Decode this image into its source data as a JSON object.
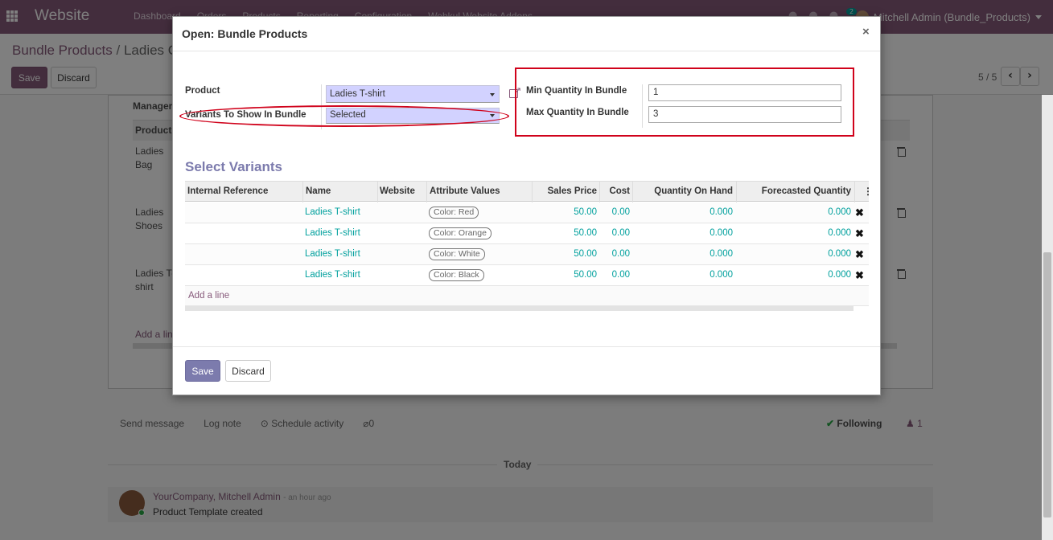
{
  "navbar": {
    "brand": "Website",
    "menu": [
      "Dashboard",
      "Orders",
      "Products",
      "Reporting",
      "Configuration",
      "Webkul Website Addons"
    ],
    "chat_count": "2",
    "user": "Mitchell Admin (Bundle_Products)"
  },
  "breadcrumb": {
    "parent": "Bundle Products",
    "separator": "/",
    "current": "Ladies C..."
  },
  "control": {
    "save": "Save",
    "discard": "Discard",
    "pager": "5 / 5"
  },
  "sheet": {
    "section": "Managem",
    "col_product": "Product",
    "rows": [
      "Ladies Bag",
      "Ladies Shoes",
      "Ladies T-shirt"
    ],
    "add_line": "Add a line"
  },
  "chatter": {
    "send_message": "Send message",
    "log_note": "Log note",
    "schedule": "Schedule activity",
    "attachments": "0",
    "following": "Following",
    "followers": "1",
    "today": "Today",
    "author": "YourCompany, Mitchell Admin",
    "time": "- an hour ago",
    "body": "Product Template created"
  },
  "modal": {
    "title": "Open: Bundle Products",
    "close": "×",
    "product_label": "Product",
    "product_value": "Ladies T-shirt",
    "variants_label": "Variants To Show In Bundle",
    "variants_value": "Selected",
    "min_label": "Min Quantity In Bundle",
    "min_value": "1",
    "max_label": "Max Quantity In Bundle",
    "max_value": "3",
    "section_title": "Select Variants",
    "columns": {
      "ref": "Internal Reference",
      "name": "Name",
      "website": "Website",
      "attr": "Attribute Values",
      "price": "Sales Price",
      "cost": "Cost",
      "qoh": "Quantity On Hand",
      "forecast": "Forecasted Quantity"
    },
    "rows": [
      {
        "name": "Ladies T-shirt",
        "attr": "Color: Red",
        "price": "50.00",
        "cost": "0.00",
        "qoh": "0.000",
        "forecast": "0.000"
      },
      {
        "name": "Ladies T-shirt",
        "attr": "Color: Orange",
        "price": "50.00",
        "cost": "0.00",
        "qoh": "0.000",
        "forecast": "0.000"
      },
      {
        "name": "Ladies T-shirt",
        "attr": "Color: White",
        "price": "50.00",
        "cost": "0.00",
        "qoh": "0.000",
        "forecast": "0.000"
      },
      {
        "name": "Ladies T-shirt",
        "attr": "Color: Black",
        "price": "50.00",
        "cost": "0.00",
        "qoh": "0.000",
        "forecast": "0.000"
      }
    ],
    "add_line": "Add a line",
    "save": "Save",
    "discard": "Discard"
  },
  "colors": {
    "primary": "#875a7b",
    "link": "#00a09d",
    "highlight": "#d0021b",
    "accent": "#7c7bad"
  },
  "icons": [
    "apps-icon",
    "external-link-icon",
    "trash-icon",
    "delete-row-icon",
    "chevron-left-icon",
    "chevron-right-icon",
    "clock-icon",
    "paperclip-icon",
    "check-icon",
    "user-icon"
  ]
}
